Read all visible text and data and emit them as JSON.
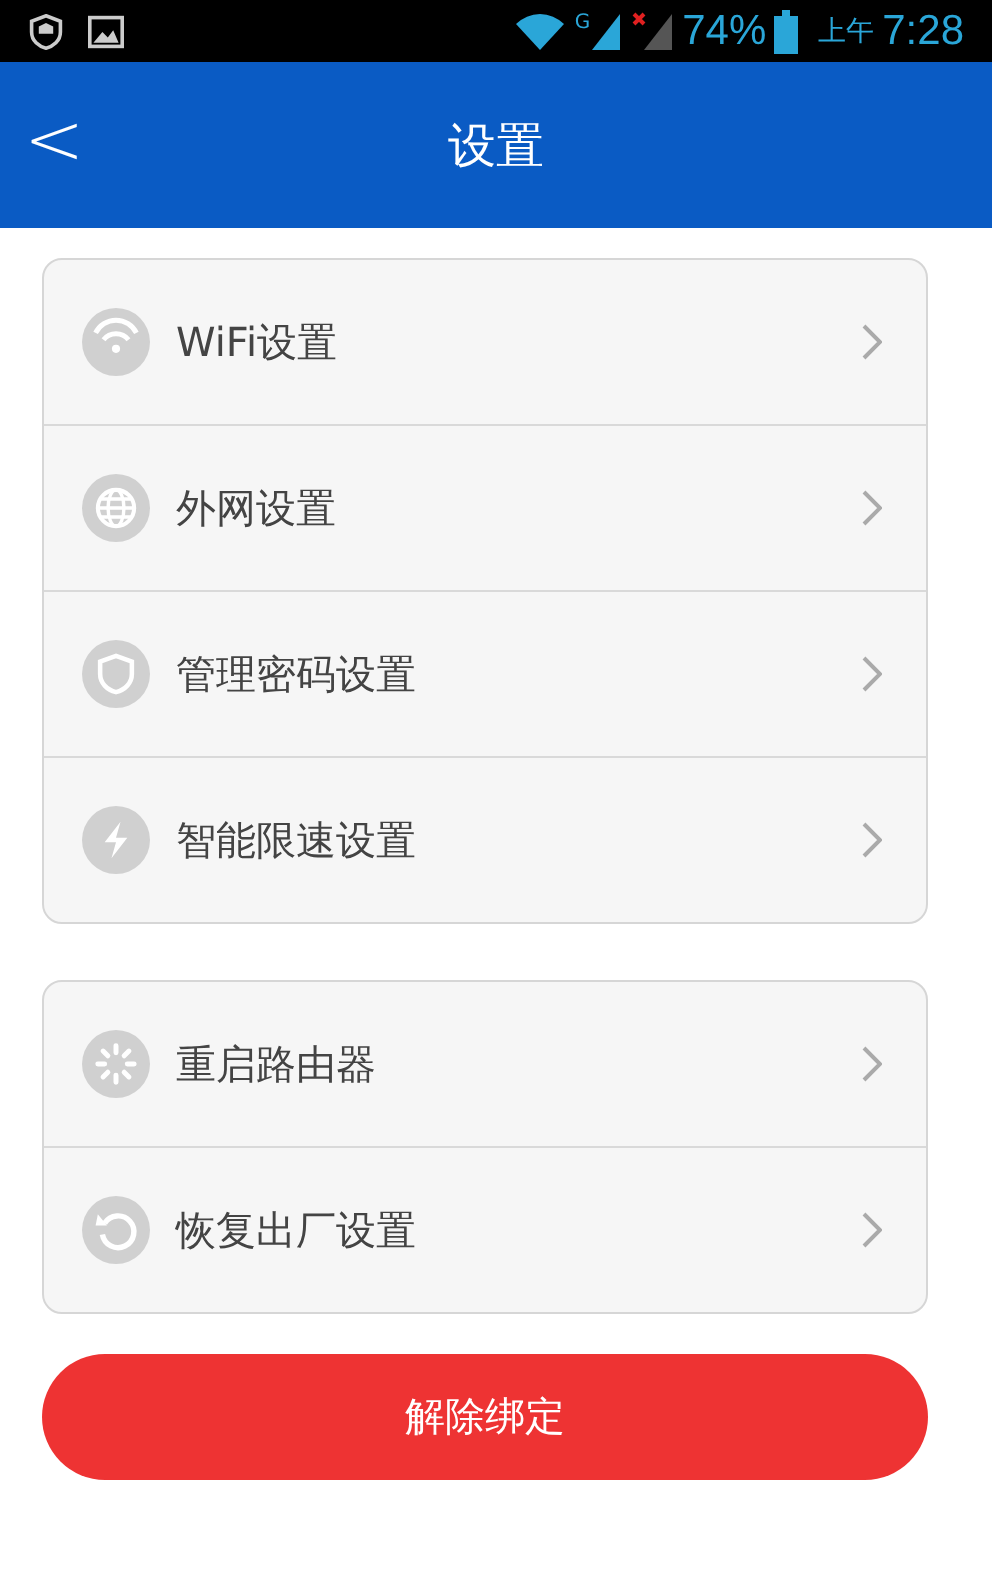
{
  "status_bar": {
    "network_type": "G",
    "battery": "74%",
    "time_period": "上午",
    "time": "7:28"
  },
  "header": {
    "back": "<",
    "title": "设置"
  },
  "groups": [
    {
      "items": [
        {
          "kind": "wifi",
          "label": "WiFi设置"
        },
        {
          "kind": "globe",
          "label": "外网设置"
        },
        {
          "kind": "shield",
          "label": "管理密码设置"
        },
        {
          "kind": "bolt",
          "label": "智能限速设置"
        }
      ]
    },
    {
      "items": [
        {
          "kind": "spinner",
          "label": "重启路由器"
        },
        {
          "kind": "restore",
          "label": "恢复出厂设置"
        }
      ]
    }
  ],
  "unbind_button": "解除绑定"
}
